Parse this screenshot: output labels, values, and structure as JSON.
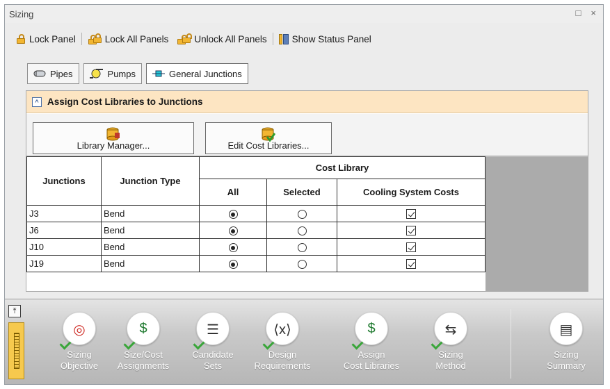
{
  "window": {
    "title": "Sizing",
    "restore_glyph": "□",
    "close_glyph": "×"
  },
  "toolbar": {
    "lock_panel": "Lock Panel",
    "lock_all": "Lock All Panels",
    "unlock_all": "Unlock All Panels",
    "show_status": "Show Status Panel"
  },
  "tabs": [
    {
      "label": "Pipes",
      "icon": "pipe-icon"
    },
    {
      "label": "Pumps",
      "icon": "pump-icon"
    },
    {
      "label": "General Junctions",
      "icon": "junction-icon",
      "active": true
    }
  ],
  "section": {
    "title": "Assign Cost Libraries to Junctions",
    "collapse_glyph": "^",
    "library_manager": "Library Manager...",
    "edit_cost_libraries": "Edit Cost Libraries..."
  },
  "grid": {
    "headers": {
      "junctions": "Junctions",
      "junction_type": "Junction Type",
      "cost_library": "Cost Library",
      "all": "All",
      "selected": "Selected",
      "cooling": "Cooling System Costs"
    },
    "rows": [
      {
        "id": "J3",
        "type": "Bend",
        "all": true,
        "selected": false,
        "cooling": true
      },
      {
        "id": "J6",
        "type": "Bend",
        "all": true,
        "selected": false,
        "cooling": true
      },
      {
        "id": "J10",
        "type": "Bend",
        "all": true,
        "selected": false,
        "cooling": true
      },
      {
        "id": "J19",
        "type": "Bend",
        "all": true,
        "selected": false,
        "cooling": true
      }
    ]
  },
  "bottom_nav": {
    "collapse_glyph": "⤒",
    "items": [
      {
        "line1": "Sizing",
        "line2": "Objective",
        "icon": "target-icon"
      },
      {
        "line1": "Size/Cost",
        "line2": "Assignments",
        "icon": "ruler-dollar-icon"
      },
      {
        "line1": "Candidate",
        "line2": "Sets",
        "icon": "list-search-icon"
      },
      {
        "line1": "Design",
        "line2": "Requirements",
        "icon": "variable-icon"
      },
      {
        "line1": "Assign",
        "line2": "Cost Libraries",
        "icon": "database-dollar-icon"
      },
      {
        "line1": "Sizing",
        "line2": "Method",
        "icon": "flowchart-icon"
      },
      {
        "line1": "Sizing",
        "line2": "Summary",
        "icon": "clipboard-icon"
      }
    ]
  },
  "colors": {
    "section_header": "#fde5c2",
    "accent_check": "#3aa63a",
    "side_tab": "#f6c94e"
  }
}
